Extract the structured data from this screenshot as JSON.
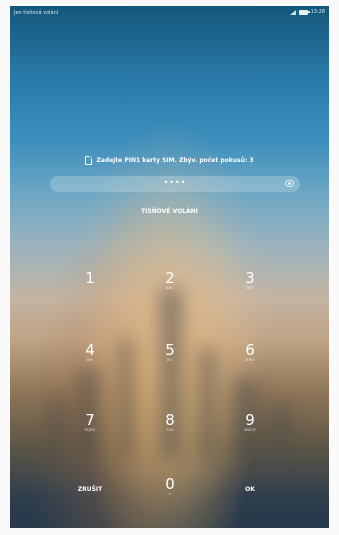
{
  "status_bar": {
    "carrier": "Jen tísňová volání",
    "time": "13:28"
  },
  "lock": {
    "prompt": "Zadejte PIN1 karty SIM. Zbýv. počet pokusů: 3",
    "pin_masked": "••••",
    "emergency_call": "TÍSŇOVÉ VOLÁNÍ"
  },
  "keypad": {
    "keys": [
      {
        "num": "1",
        "letters": ""
      },
      {
        "num": "2",
        "letters": "ABC"
      },
      {
        "num": "3",
        "letters": "DEF"
      },
      {
        "num": "4",
        "letters": "GHI"
      },
      {
        "num": "5",
        "letters": "JKL"
      },
      {
        "num": "6",
        "letters": "MNO"
      },
      {
        "num": "7",
        "letters": "PQRS"
      },
      {
        "num": "8",
        "letters": "TUV"
      },
      {
        "num": "9",
        "letters": "WXYZ"
      },
      {
        "num": "0",
        "letters": "+"
      }
    ],
    "cancel": "ZRUŠIT",
    "ok": "OK"
  },
  "icons": {
    "sim": "sim-card-icon",
    "visibility": "eye-icon",
    "signal": "signal-icon",
    "battery": "battery-icon"
  }
}
